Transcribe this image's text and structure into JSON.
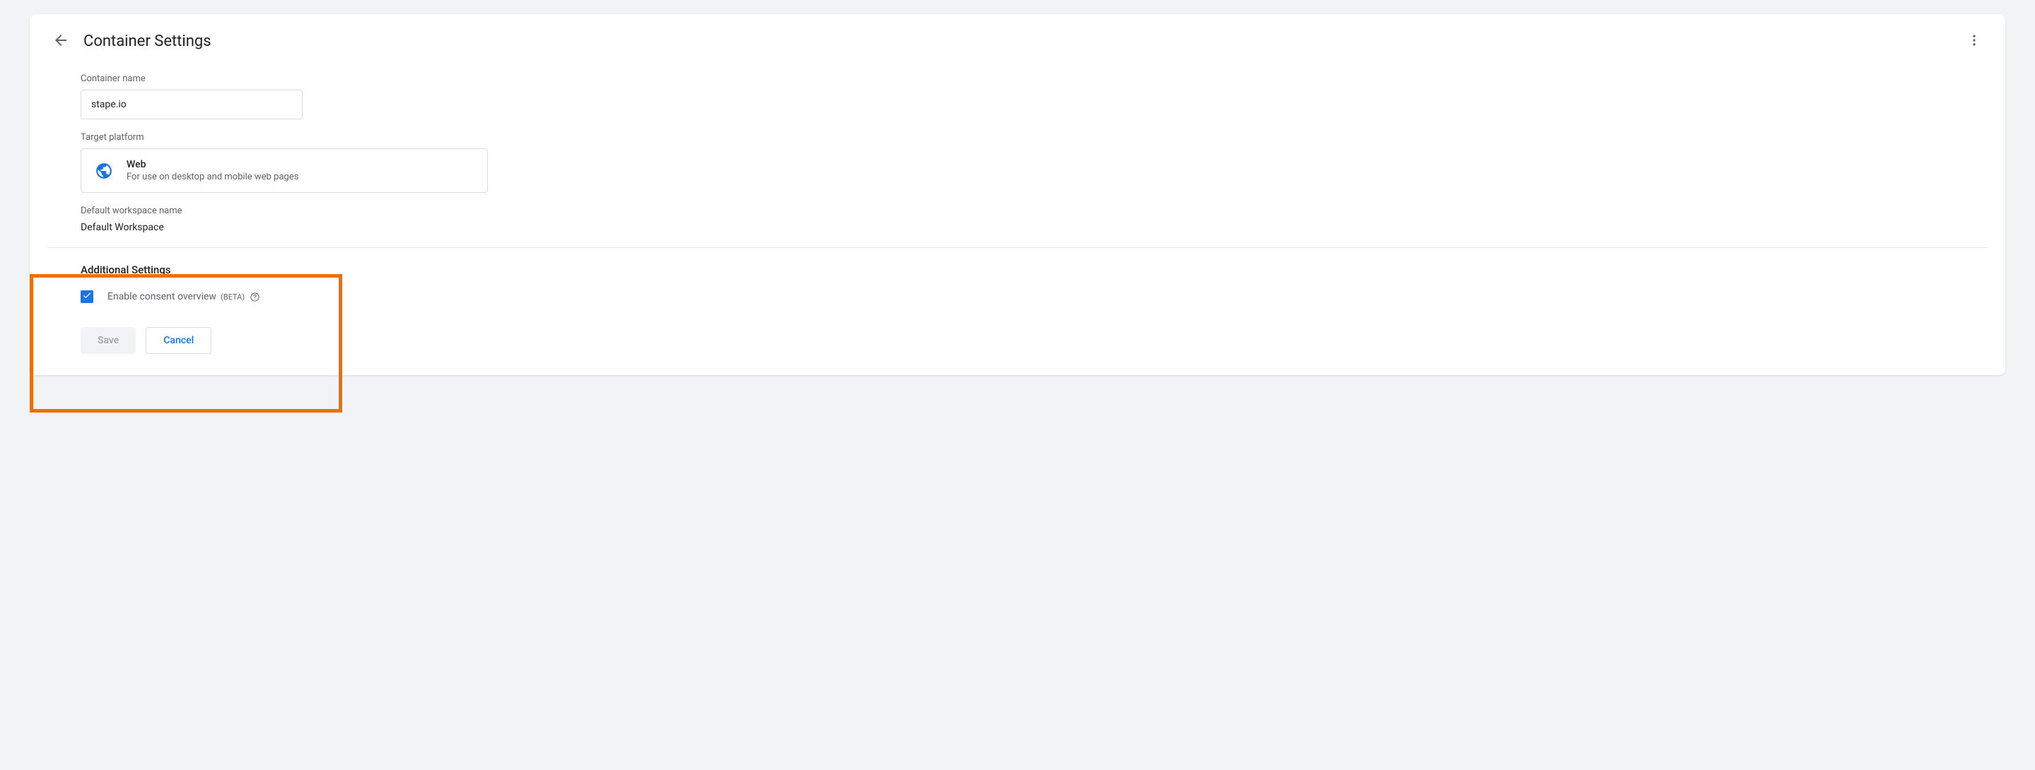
{
  "header": {
    "title": "Container Settings"
  },
  "container_name": {
    "label": "Container name",
    "value": "stape.io"
  },
  "target_platform": {
    "label": "Target platform",
    "title": "Web",
    "description": "For use on desktop and mobile web pages"
  },
  "default_workspace": {
    "label": "Default workspace name",
    "value": "Default Workspace"
  },
  "additional": {
    "title": "Additional Settings",
    "consent_label": "Enable consent overview",
    "consent_beta": "(BETA)",
    "consent_checked": true
  },
  "buttons": {
    "save": "Save",
    "cancel": "Cancel"
  }
}
